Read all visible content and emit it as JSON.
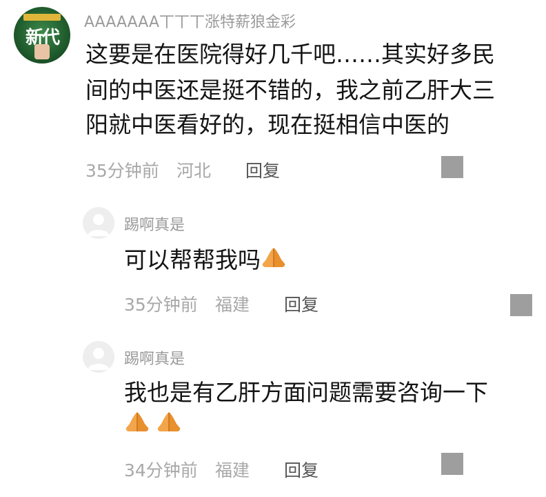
{
  "comments": [
    {
      "username": "AAAAAAA丅丅丅涨特薪狼金彩",
      "avatar_text": "新代",
      "lines": [
        "这要是在医院得好几千吧……其实好多民",
        "间的中医还是挺不错的，我之前乙肝大三",
        "阳就中医看好的，现在挺相信中医的"
      ],
      "time": "35分钟前",
      "location": "河北",
      "reply_label": "回复"
    }
  ],
  "replies": [
    {
      "username": "踢啊真是",
      "text": "可以帮帮我吗",
      "emoji": "folded-hands",
      "time": "35分钟前",
      "location": "福建",
      "reply_label": "回复"
    },
    {
      "username": "踢啊真是",
      "text": "我也是有乙肝方面问题需要咨询一下",
      "emoji_line": [
        "folded-hands",
        "folded-hands"
      ],
      "time": "34分钟前",
      "location": "福建",
      "reply_label": "回复"
    }
  ],
  "colors": {
    "username": "#9a9a9a",
    "meta": "#a8a8a8",
    "reply": "#555555",
    "text": "#141414",
    "more_icon": "#9e9e9e",
    "emoji": "#f2a54a"
  }
}
